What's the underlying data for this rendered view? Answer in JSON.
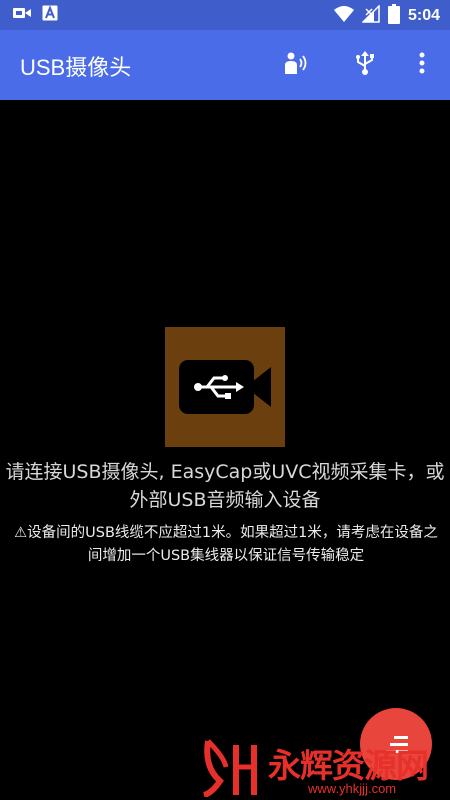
{
  "status_bar": {
    "time": "5:04",
    "left_icons": [
      "video-call-icon",
      "a-badge-icon"
    ],
    "right_icons": [
      "wifi-icon",
      "signal-icon",
      "battery-icon"
    ]
  },
  "app_bar": {
    "title": "USB摄像头",
    "actions": [
      "speak-icon",
      "usb-icon",
      "more-vert-icon"
    ]
  },
  "main": {
    "primary_message": "请连接USB摄像头, EasyCap或UVC视频采集卡，或外部USB音频输入设备",
    "secondary_message": "⚠设备间的USB线缆不应超过1米。如果超过1米，请考虑在设备之间增加一个USB集线器以保证信号传输稳定"
  },
  "watermark": {
    "text": "永辉资源网",
    "url": "www.yhkjjj.com"
  },
  "colors": {
    "status_bar": "#3F5ECB",
    "app_bar": "#4A6CE8",
    "background": "#000000",
    "icon_box": "#6B3F0E",
    "fab": "#E8453C",
    "watermark": "#E8302A"
  }
}
